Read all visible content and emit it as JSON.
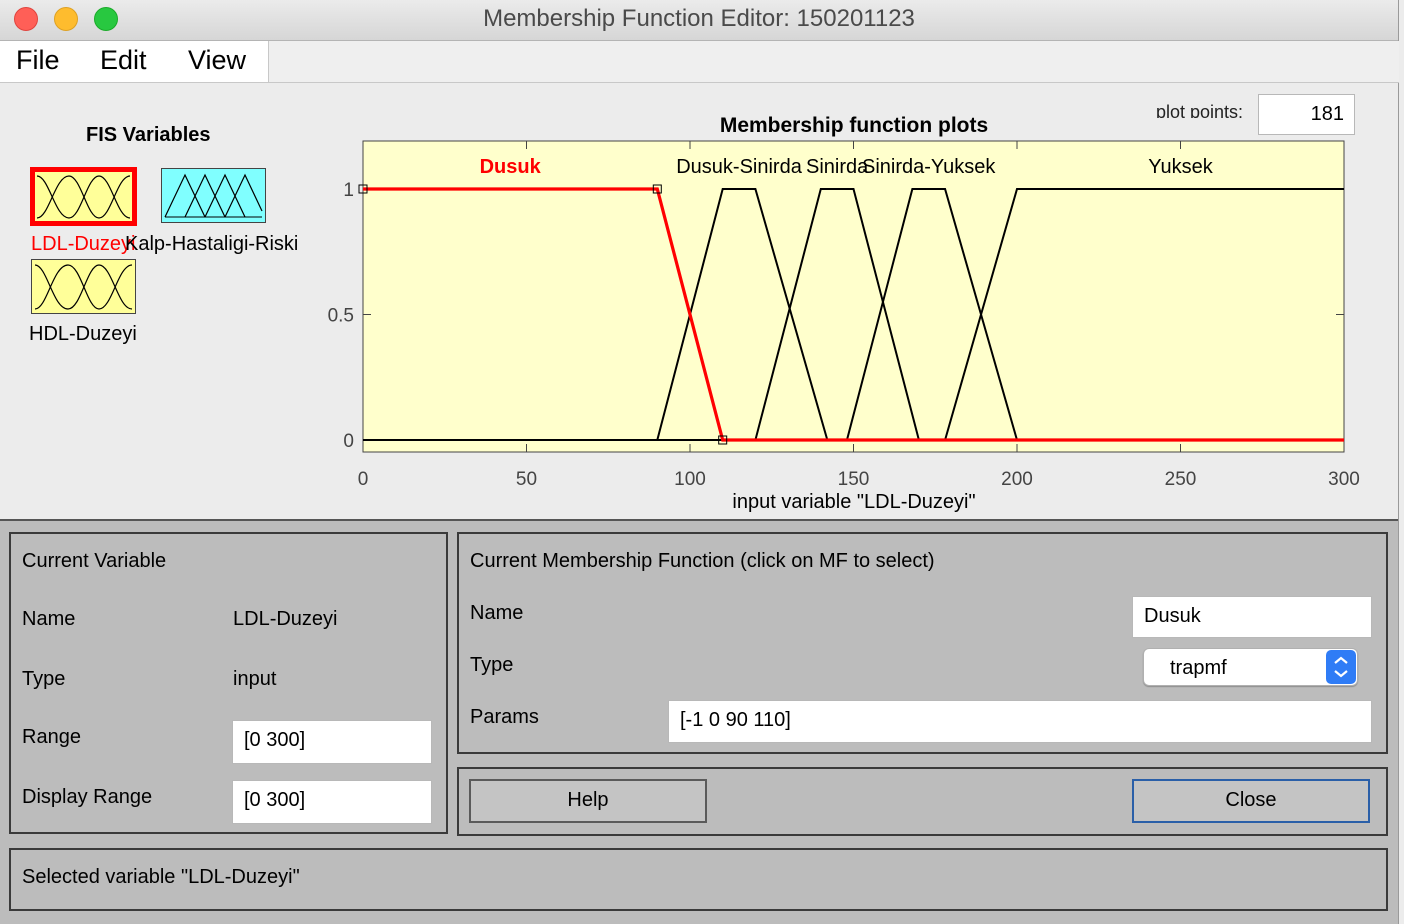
{
  "window": {
    "title": "Membership Function Editor: 150201123",
    "traffic_lights": {
      "close": "#ff5f57",
      "minimize": "#febc2e",
      "zoom": "#28c840"
    }
  },
  "menu": [
    "File",
    "Edit",
    "View"
  ],
  "fis_variables": {
    "heading": "FIS Variables",
    "items": [
      {
        "label": "LDL-Duzeyi",
        "kind": "input",
        "selected": true,
        "color": "#ffff99"
      },
      {
        "label": "Kalp-Hastaligi-Riski",
        "kind": "output",
        "selected": false,
        "color": "#80ffff"
      },
      {
        "label": "HDL-Duzeyi",
        "kind": "input",
        "selected": false,
        "color": "#ffff99"
      }
    ]
  },
  "plot_points": {
    "label": "plot points:",
    "value": "181"
  },
  "chart_data": {
    "type": "line",
    "title": "Membership function plots",
    "xlabel": "input variable \"LDL-Duzeyi\"",
    "ylabel": "",
    "xlim": [
      0,
      300
    ],
    "ylim": [
      0,
      1
    ],
    "xticks": [
      "0",
      "50",
      "100",
      "150",
      "200",
      "250",
      "300"
    ],
    "yticks": [
      "0",
      "0.5",
      "1"
    ],
    "background": "#ffffcc",
    "selected_color": "#ff0000",
    "series": [
      {
        "name": "Dusuk",
        "params": [
          -1,
          0,
          90,
          110
        ],
        "x": [
          0,
          90,
          110,
          300
        ],
        "y": [
          1,
          1,
          0,
          0
        ],
        "selected": true
      },
      {
        "name": "Dusuk-Sinirda",
        "x": [
          0,
          90,
          110,
          120,
          142,
          300
        ],
        "y": [
          0,
          0,
          1,
          1,
          0,
          0
        ],
        "selected": false
      },
      {
        "name": "Sinirda",
        "x": [
          0,
          120,
          140,
          150,
          170,
          300
        ],
        "y": [
          0,
          0,
          1,
          1,
          0,
          0
        ],
        "selected": false
      },
      {
        "name": "Sinirda-Yuksek",
        "x": [
          0,
          148,
          168,
          178,
          200,
          300
        ],
        "y": [
          0,
          0,
          1,
          1,
          0,
          0
        ],
        "selected": false
      },
      {
        "name": "Yuksek",
        "x": [
          0,
          178,
          200,
          300
        ],
        "y": [
          0,
          0,
          1,
          1
        ],
        "selected": false
      }
    ]
  },
  "current_variable": {
    "heading": "Current Variable",
    "name_label": "Name",
    "name_value": "LDL-Duzeyi",
    "type_label": "Type",
    "type_value": "input",
    "range_label": "Range",
    "range_value": "[0 300]",
    "display_range_label": "Display Range",
    "display_range_value": "[0 300]"
  },
  "current_mf": {
    "heading": "Current Membership Function (click on MF to select)",
    "name_label": "Name",
    "name_value": "Dusuk",
    "type_label": "Type",
    "type_value": "trapmf",
    "params_label": "Params",
    "params_value": "[-1 0 90 110]"
  },
  "buttons": {
    "help": "Help",
    "close": "Close"
  },
  "status": "Selected variable \"LDL-Duzeyi\""
}
